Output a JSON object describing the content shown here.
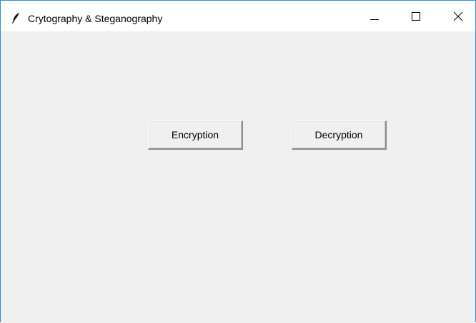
{
  "window": {
    "title": "Crytography & Steganography",
    "icon": "feather-icon",
    "controls": [
      "minimize-icon",
      "maximize-icon",
      "close-icon"
    ]
  },
  "main": {
    "encryption_label": "Encryption",
    "decryption_label": "Decryption"
  },
  "colors": {
    "background": "#f0f0f0",
    "titlebar": "#ffffff",
    "window_border": "#2b8fd6"
  }
}
